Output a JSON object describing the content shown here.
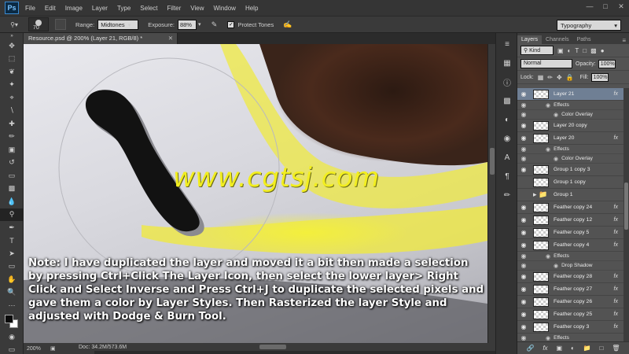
{
  "app": {
    "logo": "Ps",
    "menus": [
      "File",
      "Edit",
      "Image",
      "Layer",
      "Type",
      "Select",
      "Filter",
      "View",
      "Window",
      "Help"
    ],
    "window_controls": [
      "minimize-icon",
      "maximize-icon",
      "close-icon"
    ]
  },
  "options": {
    "brush_size": "70",
    "range_label": "Range:",
    "range_value": "Midtones",
    "exposure_label": "Exposure:",
    "exposure_value": "88%",
    "protect_tones_label": "Protect Tones",
    "protect_tones_checked": true,
    "workspace": "Typography"
  },
  "document": {
    "tab_title": "Resource.psd @ 200% (Layer 21, RGB/8) *",
    "zoom": "200%",
    "doc_info": "Doc: 34.2M/573.6M"
  },
  "canvas": {
    "watermark": "www.cgtsj.com",
    "note": "Note: I have duplicated the layer and moved it a bit then made a selection by pressing Ctrl+Click The Layer Icon, then select the lower layer> Right Click and Select Inverse and Press Ctrl+J to duplicate the selected pixels and gave them a color by Layer Styles. Then Rasterized the layer Style and adjusted with Dodge & Burn Tool."
  },
  "layers_panel": {
    "tabs": [
      "Layers",
      "Channels",
      "Paths"
    ],
    "filter_kind": "Kind",
    "blend_mode": "Normal",
    "opacity_label": "Opacity:",
    "opacity_value": "100%",
    "lock_label": "Lock:",
    "fill_label": "Fill:",
    "fill_value": "100%",
    "layers": [
      {
        "name": "Layer 21",
        "fx": true,
        "selected": true,
        "visible": true,
        "effects": [
          "Effects",
          "Color Overlay"
        ]
      },
      {
        "name": "Layer 20 copy",
        "fx": false,
        "visible": true
      },
      {
        "name": "Layer 20",
        "fx": true,
        "visible": true,
        "effects": [
          "Effects",
          "Color Overlay"
        ]
      },
      {
        "name": "Group 1 copy 3",
        "fx": false,
        "visible": true
      },
      {
        "name": "Group 1 copy",
        "fx": false,
        "visible": false
      },
      {
        "name": "Group 1",
        "fx": false,
        "visible": false,
        "folder": true
      },
      {
        "name": "Feather copy 24",
        "fx": true,
        "visible": true
      },
      {
        "name": "Feather copy 12",
        "fx": true,
        "visible": true
      },
      {
        "name": "Feather copy 5",
        "fx": true,
        "visible": true
      },
      {
        "name": "Feather copy 4",
        "fx": true,
        "visible": true,
        "effects": [
          "Effects",
          "Drop Shadow"
        ]
      },
      {
        "name": "Feather copy 28",
        "fx": true,
        "visible": true
      },
      {
        "name": "Feather copy 27",
        "fx": true,
        "visible": true
      },
      {
        "name": "Feather copy 26",
        "fx": true,
        "visible": true
      },
      {
        "name": "Feather copy 25",
        "fx": true,
        "visible": true
      },
      {
        "name": "Feather copy 3",
        "fx": true,
        "visible": true,
        "effects": [
          "Effects"
        ]
      }
    ],
    "fx_label": "fx"
  }
}
